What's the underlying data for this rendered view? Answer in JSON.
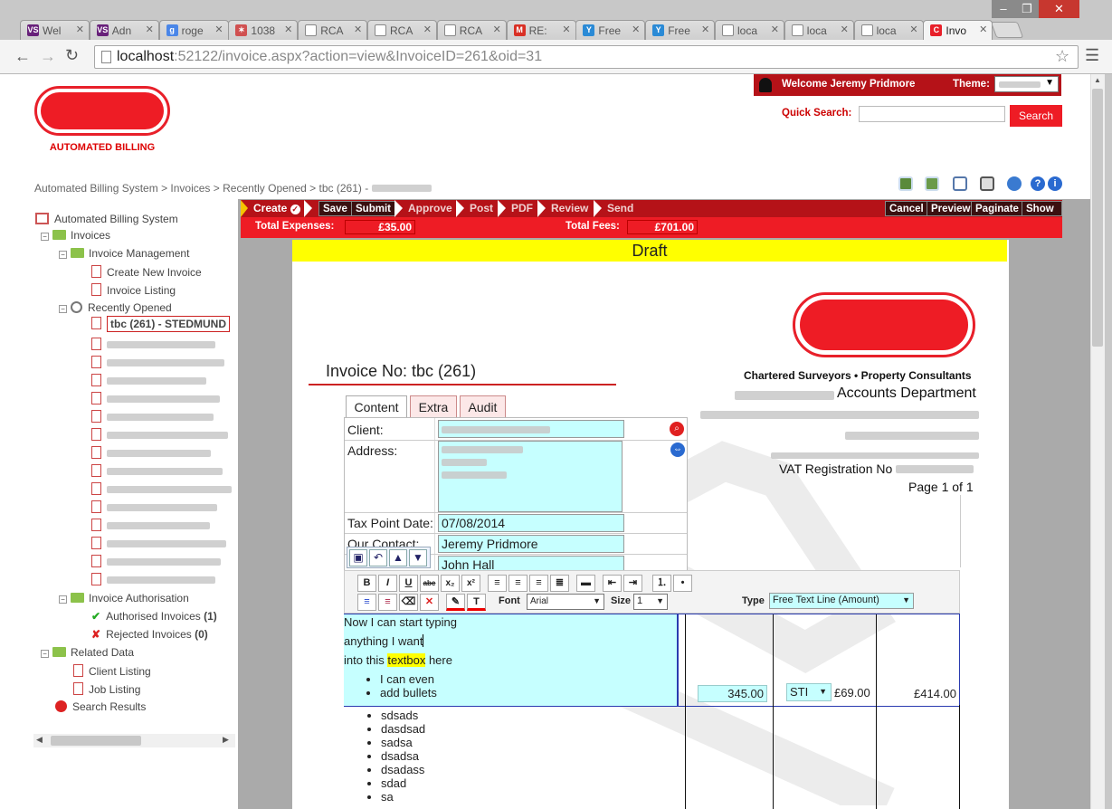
{
  "browser": {
    "tabs": [
      {
        "label": "Wel",
        "fav": "VS",
        "color": "#68217a"
      },
      {
        "label": "Adn",
        "fav": "VS",
        "color": "#68217a"
      },
      {
        "label": "roge",
        "fav": "g",
        "color": "#4a86e8"
      },
      {
        "label": "1038",
        "fav": "✶",
        "color": "#d05050"
      },
      {
        "label": "RCA",
        "fav": "",
        "color": "#fff"
      },
      {
        "label": "RCA",
        "fav": "",
        "color": "#fff"
      },
      {
        "label": "RCA",
        "fav": "",
        "color": "#fff"
      },
      {
        "label": "RE:",
        "fav": "M",
        "color": "#d93025"
      },
      {
        "label": "Free",
        "fav": "Y",
        "color": "#2a8ad6"
      },
      {
        "label": "Free",
        "fav": "Y",
        "color": "#2a8ad6"
      },
      {
        "label": "loca",
        "fav": "",
        "color": "#fff"
      },
      {
        "label": "loca",
        "fav": "",
        "color": "#fff"
      },
      {
        "label": "loca",
        "fav": "",
        "color": "#fff"
      },
      {
        "label": "Invo",
        "fav": "C",
        "color": "#e8202a"
      }
    ],
    "url_host": "localhost",
    "url_rest": ":52122/invoice.aspx?action=view&InvoiceID=261&oid=31"
  },
  "header": {
    "logo_text": "AUTOMATED BILLING",
    "welcome": "Welcome Jeremy Pridmore",
    "theme_label": "Theme:",
    "quick_search_label": "Quick Search:",
    "search_button": "Search"
  },
  "breadcrumb": {
    "text": "Automated Billing System > Invoices > Recently Opened > tbc (261) -"
  },
  "tree": {
    "root": "Automated Billing System",
    "invoices": "Invoices",
    "invoice_management": "Invoice Management",
    "create_new_invoice": "Create New Invoice",
    "invoice_listing": "Invoice Listing",
    "recently_opened": "Recently Opened",
    "current": "tbc (261) - STEDMUND",
    "invoice_authorisation": "Invoice Authorisation",
    "authorised": "Authorised Invoices",
    "authorised_count": "(1)",
    "rejected": "Rejected Invoices",
    "rejected_count": "(0)",
    "related_data": "Related Data",
    "client_listing": "Client Listing",
    "job_listing": "Job Listing",
    "search_results": "Search Results"
  },
  "workflow": {
    "create": "Create",
    "save": "Save",
    "submit": "Submit",
    "approve": "Approve",
    "post": "Post",
    "pdf": "PDF",
    "review": "Review",
    "send": "Send",
    "cancel": "Cancel",
    "preview": "Preview",
    "paginate": "Paginate",
    "show": "Show"
  },
  "totals": {
    "expenses_label": "Total Expenses:",
    "expenses_value": "£35.00",
    "fees_label": "Total Fees:",
    "fees_value": "£701.00"
  },
  "invoice": {
    "status": "Draft",
    "number": "Invoice No: tbc (261)",
    "tabs": [
      "Content",
      "Extra",
      "Audit"
    ],
    "client_label": "Client:",
    "address_label": "Address:",
    "tax_point_label": "Tax Point Date:",
    "tax_point_value": "07/08/2014",
    "contact_label": "Our Contact:",
    "contact_value": "Jeremy Pridmore",
    "partner_value": "John Hall",
    "company_tag": "Chartered Surveyors • Property Consultants",
    "department": "Accounts Department",
    "vat_label": "VAT Registration No",
    "page": "Page 1 of 1"
  },
  "editor": {
    "font_label": "Font",
    "font_value": "Arial",
    "size_label": "Size",
    "size_value": "1",
    "type_label": "Type",
    "type_value": "Free Text Line (Amount)",
    "line1": "Now I can start typing",
    "line2": "anything I want",
    "line3_pre": "into this ",
    "line3_hl": "textbox",
    "line3_post": " here",
    "bullets": [
      "I can even",
      "add bullets"
    ],
    "amount": "345.00",
    "vat_code": "STI",
    "vat_amount": "£69.00",
    "total": "£414.00",
    "more_bullets": [
      "sdsads",
      "dasdsad",
      "sadsa",
      "dsadsa",
      "dsadass",
      "sdad",
      "sa"
    ]
  }
}
